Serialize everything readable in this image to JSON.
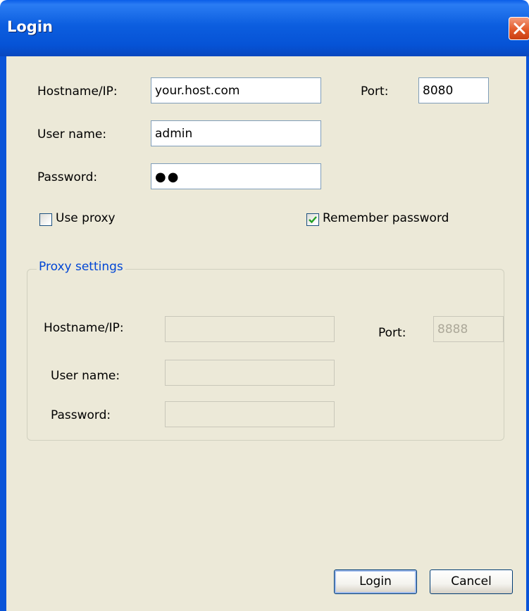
{
  "window": {
    "title": "Login"
  },
  "login": {
    "hostname_label": "Hostname/IP:",
    "hostname_value": "your.host.com",
    "port_label": "Port:",
    "port_value": "8080",
    "username_label": "User name:",
    "username_value": "admin",
    "password_label": "Password:",
    "password_value": "●●",
    "use_proxy_label": "Use proxy",
    "use_proxy_checked": false,
    "remember_label": "Remember password",
    "remember_checked": true
  },
  "proxy": {
    "group_title": "Proxy settings",
    "hostname_label": "Hostname/IP:",
    "hostname_value": "",
    "port_label": "Port:",
    "port_value": "8888",
    "username_label": "User name:",
    "username_value": "",
    "password_label": "Password:",
    "password_value": ""
  },
  "buttons": {
    "login": "Login",
    "cancel": "Cancel"
  },
  "icons": {
    "close": "close-icon",
    "check": "check-icon"
  },
  "colors": {
    "titlebar": "#0a5ee8",
    "dialog_bg": "#ece9d8",
    "group_title": "#0046d5",
    "close_button": "#e35a2a"
  }
}
